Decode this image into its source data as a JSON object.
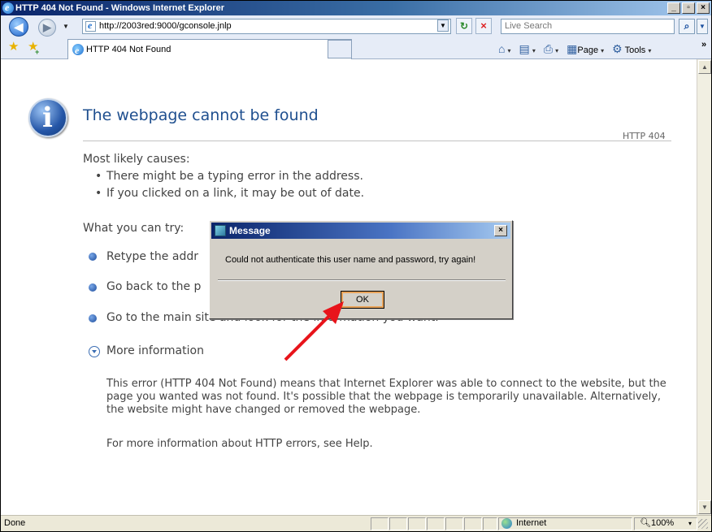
{
  "window": {
    "title": "HTTP 404 Not Found - Windows Internet Explorer",
    "min_glyph": "_",
    "max_glyph": "▫",
    "close_glyph": "×"
  },
  "nav": {
    "back_glyph": "◀",
    "fwd_glyph": "▶",
    "dd_glyph": "▼",
    "url": "http://2003red:9000/gconsole.jnlp",
    "refresh_glyph": "↻",
    "stop_glyph": "×",
    "search_placeholder": "Live Search",
    "search_glyph": "⌕"
  },
  "tabs": [
    {
      "label": "HTTP 404 Not Found"
    }
  ],
  "commandbar": {
    "page_label": "Page",
    "tools_label": "Tools",
    "chevron": "»",
    "home_icon": "⌂",
    "feeds_icon": "▤",
    "print_icon": "⎙",
    "page_icon": "▦",
    "tools_icon": "⚙",
    "dd": "▾"
  },
  "page": {
    "title": "The webpage cannot be found",
    "code": "HTTP 404",
    "causes_heading": "Most likely causes:",
    "causes": [
      "There might be a typing error in the address.",
      "If you clicked on a link, it may be out of date."
    ],
    "try_heading": "What you can try:",
    "try_items": [
      "Retype the addr",
      "Go back to the p",
      "Go to the main site and look for the information you want."
    ],
    "more_info": "More information",
    "explanation": "This error (HTTP 404 Not Found) means that Internet Explorer was able to connect to the website, but the page you wanted was not found. It's possible that the webpage is temporarily unavailable. Alternatively, the website might have changed or removed the webpage.",
    "help_line": "For more information about HTTP errors, see Help."
  },
  "dialog": {
    "title": "Message",
    "message": "Could not authenticate this user name and password, try again!",
    "ok_label": "OK",
    "close_glyph": "×"
  },
  "status": {
    "text": "Done",
    "zone": "Internet",
    "zoom": "100%"
  },
  "scrollbar": {
    "up_glyph": "▲",
    "down_glyph": "▼"
  },
  "colors": {
    "arrow": "#e8141b",
    "title_blue": "#1f4f8f",
    "ok_highlight": "#e8a35a"
  }
}
